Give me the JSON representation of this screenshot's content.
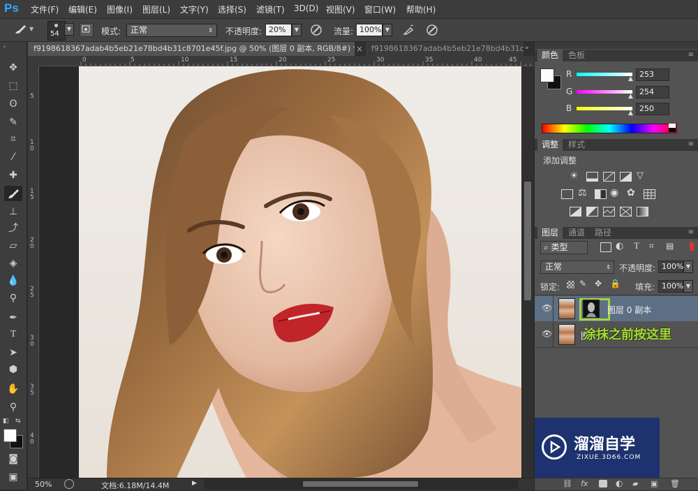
{
  "app": {
    "logo": "Ps"
  },
  "menu": [
    "文件(F)",
    "编辑(E)",
    "图像(I)",
    "图层(L)",
    "文字(Y)",
    "选择(S)",
    "滤镜(T)",
    "3D(D)",
    "视图(V)",
    "窗口(W)",
    "帮助(H)"
  ],
  "options": {
    "brush_size": "54",
    "mode_label": "模式:",
    "mode_value": "正常",
    "opacity_label": "不透明度:",
    "opacity_value": "20%",
    "flow_label": "流量:",
    "flow_value": "100%"
  },
  "tabs": [
    {
      "label": "f9198618367adab4b5eb21e78bd4b31c8701e45f.jpg @ 50% (图层 0 副本, RGB/8#) *",
      "close": "×",
      "active": true
    },
    {
      "label": "f9198618367adab4b5eb21e78bd4b31c",
      "active": false
    }
  ],
  "ruler": {
    "top": [
      "0",
      "5",
      "10",
      "15",
      "20",
      "25",
      "30",
      "35",
      "40",
      "45"
    ],
    "left": [
      "5",
      "1\n0",
      "1\n5",
      "2\n0",
      "2\n5",
      "3\n0",
      "3\n5",
      "4\n0"
    ]
  },
  "status": {
    "zoom": "50%",
    "doc": "文档:6.18M/14.4M"
  },
  "color_panel": {
    "tabs": [
      "颜色",
      "色板"
    ],
    "channels": [
      {
        "name": "R",
        "value": "253",
        "gradient": "#00ffff"
      },
      {
        "name": "G",
        "value": "254",
        "gradient": "#ff00ff"
      },
      {
        "name": "B",
        "value": "250",
        "gradient": "#ffff00"
      }
    ]
  },
  "adjust_panel": {
    "tabs": [
      "调整",
      "样式"
    ],
    "title": "添加调整"
  },
  "layers_panel": {
    "tabs": [
      "图层",
      "通道",
      "路径"
    ],
    "filter_kind": "类型",
    "blend_mode": "正常",
    "opacity_label": "不透明度:",
    "opacity_value": "100%",
    "lock_label": "锁定:",
    "fill_label": "填充:",
    "fill_value": "100%",
    "layers": [
      {
        "name": "图层 0 副本",
        "selected": true
      },
      {
        "name": "图",
        "selected": false
      }
    ],
    "annotation": "涂抹之前按这里"
  },
  "watermark": {
    "title": "溜溜自学",
    "url": "ZIXUE.3D66.COM"
  },
  "colors": {
    "accent": "#31a8ff",
    "highlight": "#a5d63f",
    "lips": "#c0252a",
    "selected_layer": "#5d6f84"
  }
}
